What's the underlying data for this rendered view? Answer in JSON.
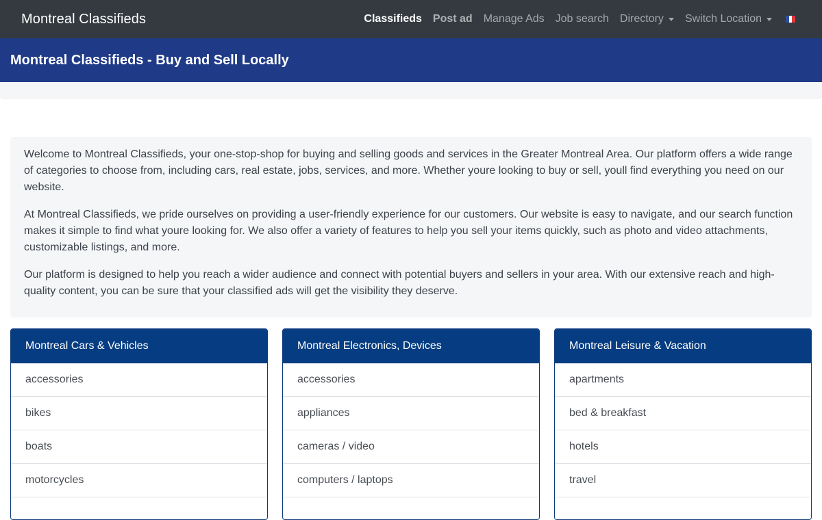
{
  "navbar": {
    "brand": "Montreal Classifieds",
    "links": [
      {
        "label": "Classifieds"
      },
      {
        "label": "Post ad"
      },
      {
        "label": "Manage Ads"
      },
      {
        "label": "Job search"
      },
      {
        "label": "Directory"
      },
      {
        "label": "Switch Location"
      }
    ],
    "flag_icon": "flag-france-icon",
    "flag_colors": [
      "#2c4ea3",
      "#ffffff",
      "#e0373a"
    ]
  },
  "header": {
    "title": "Montreal Classifieds - Buy and Sell Locally"
  },
  "intro": {
    "paragraphs": [
      "Welcome to Montreal Classifieds, your one-stop-shop for buying and selling goods and services in the Greater Montreal Area. Our platform offers a wide range of categories to choose from, including cars, real estate, jobs, services, and more. Whether youre looking to buy or sell, youll find everything you need on our website.",
      "At Montreal Classifieds, we pride ourselves on providing a user-friendly experience for our customers. Our website is easy to navigate, and our search function makes it simple to find what youre looking for. We also offer a variety of features to help you sell your items quickly, such as photo and video attachments, customizable listings, and more.",
      "Our platform is designed to help you reach a wider audience and connect with potential buyers and sellers in your area. With our extensive reach and high-quality content, you can be sure that your classified ads will get the visibility they deserve."
    ]
  },
  "categories": [
    {
      "title": "Montreal Cars & Vehicles",
      "items": [
        "accessories",
        "bikes",
        "boats",
        "motorcycles"
      ]
    },
    {
      "title": "Montreal Electronics, Devices",
      "items": [
        "accessories",
        "appliances",
        "cameras / video",
        "computers / laptops"
      ]
    },
    {
      "title": "Montreal Leisure & Vacation",
      "items": [
        "apartments",
        "bed & breakfast",
        "hotels",
        "travel"
      ]
    }
  ],
  "colors": {
    "navbar_bg": "#343a40",
    "header_bg": "#1f3a87",
    "card_header_bg": "#063d82"
  }
}
